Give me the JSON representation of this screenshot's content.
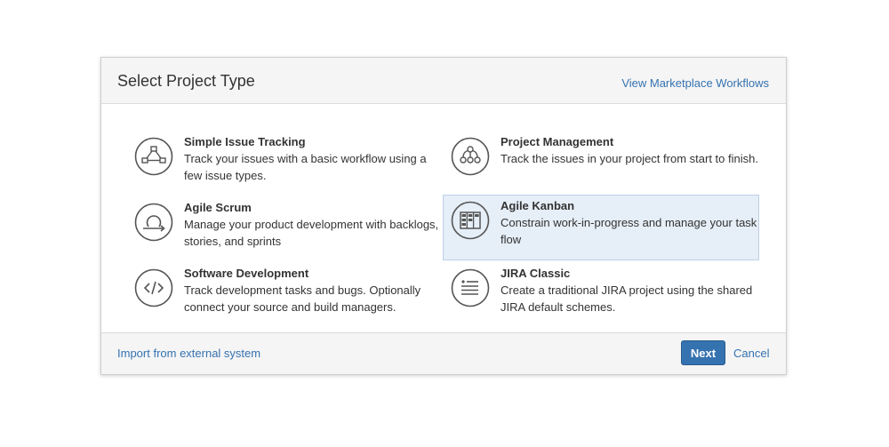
{
  "dialog": {
    "title": "Select Project Type",
    "marketplace_link": "View Marketplace Workflows"
  },
  "options": [
    {
      "id": "simple-issue-tracking",
      "title": "Simple Issue Tracking",
      "description": "Track your issues with a basic workflow using a few issue types.",
      "icon": "workflow-icon",
      "selected": false
    },
    {
      "id": "project-management",
      "title": "Project Management",
      "description": "Track the issues in your project from start to finish.",
      "icon": "project-management-icon",
      "selected": false
    },
    {
      "id": "agile-scrum",
      "title": "Agile Scrum",
      "description": "Manage your product development with backlogs, stories, and sprints",
      "icon": "scrum-cycle-icon",
      "selected": false
    },
    {
      "id": "agile-kanban",
      "title": "Agile Kanban",
      "description": "Constrain work-in-progress and manage your task flow",
      "icon": "kanban-board-icon",
      "selected": true
    },
    {
      "id": "software-development",
      "title": "Software Development",
      "description": "Track development tasks and bugs. Optionally connect your source and build managers.",
      "icon": "code-icon",
      "selected": false
    },
    {
      "id": "jira-classic",
      "title": "JIRA Classic",
      "description": "Create a traditional JIRA project using the shared JIRA default schemes.",
      "icon": "list-icon",
      "selected": false
    }
  ],
  "footer": {
    "import_link": "Import from external system",
    "next_label": "Next",
    "cancel_label": "Cancel"
  },
  "colors": {
    "link": "#3572b0",
    "primary_button": "#3572b0",
    "selected_background": "#e6eef7",
    "header_background": "#f5f5f5",
    "icon_stroke": "#555555"
  }
}
